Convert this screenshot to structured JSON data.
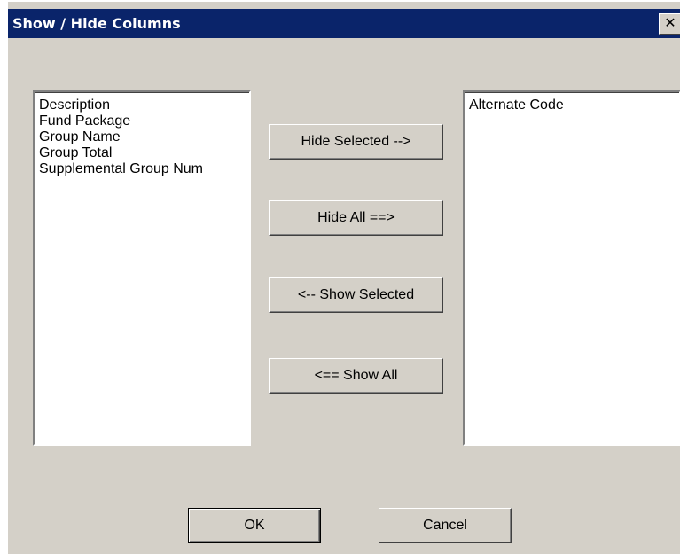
{
  "dialog": {
    "title": "Show / Hide Columns",
    "close_glyph": "✕"
  },
  "visible_columns": {
    "items": [
      "Description",
      "Fund Package",
      "Group Name",
      "Group Total",
      "Supplemental Group Num"
    ]
  },
  "hidden_columns": {
    "items": [
      "Alternate Code"
    ]
  },
  "buttons": {
    "hide_selected": "Hide Selected -->",
    "hide_all": "Hide All ==>",
    "show_selected": "<-- Show Selected",
    "show_all": "<== Show All",
    "ok": "OK",
    "cancel": "Cancel"
  },
  "colors": {
    "titlebar": "#0a246a",
    "dialog_face": "#d4d0c8",
    "list_background": "#ffffff"
  }
}
